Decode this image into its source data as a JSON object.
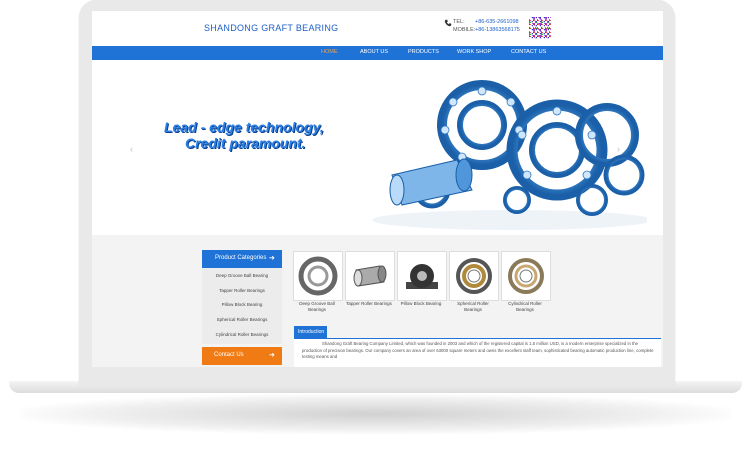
{
  "brand": {
    "name": "SHANDONG GRAFT BEARING"
  },
  "contact_header": {
    "tel_label": "TEL:",
    "tel_value": "+86-635-2661098",
    "mobile_label": "MOBILE:",
    "mobile_value": "+86-13863568175"
  },
  "nav": {
    "items": [
      {
        "label": "HOME"
      },
      {
        "label": "ABOUT US"
      },
      {
        "label": "PRODUCTS"
      },
      {
        "label": "WORK SHOP"
      },
      {
        "label": "CONTACT US"
      }
    ],
    "active_index": 0
  },
  "banner": {
    "line1": "Lead - edge  technology,",
    "line2": "Credit  paramount.",
    "prev_arrow": "‹",
    "next_arrow": "›"
  },
  "sidebar": {
    "categories_title": "Product Categories",
    "categories_arrow": "➜",
    "items": [
      {
        "label": "Deep Groove Ball Bearing"
      },
      {
        "label": "Tapper Roller Bearings"
      },
      {
        "label": "Pillow Block Bearing"
      },
      {
        "label": "Spherical Roller Bearings"
      },
      {
        "label": "Cylindrical Roller Bearings"
      }
    ],
    "contact_title": "Contact Us",
    "contact_arrow": "➜"
  },
  "products": [
    {
      "line1": "Deep Groove Ball",
      "line2": "Bearings"
    },
    {
      "line1": "Tapper Roller Bearings",
      "line2": ""
    },
    {
      "line1": "Pillow Block Bearing",
      "line2": ""
    },
    {
      "line1": "Spherical Roller Bearings",
      "line2": ""
    },
    {
      "line1": "Cylindrical Roller",
      "line2": "Bearings"
    }
  ],
  "intro": {
    "tab_label": "Introduction",
    "text": "Shandong Graft Bearing Company Limited, which was founded in 2003 and which of the registered capital is 1.5 million USD, is a modern enterprise specialized in the production of precision bearings. Our company covers an area of over 63000 square meters and owns the excellent staff team, sophisticated bearing automatic production line, complete testing means and"
  },
  "colors": {
    "nav_blue": "#1f73d6",
    "contact_orange": "#f07a14",
    "active_nav": "#f0a050",
    "brand_blue": "#1d5fc9"
  }
}
